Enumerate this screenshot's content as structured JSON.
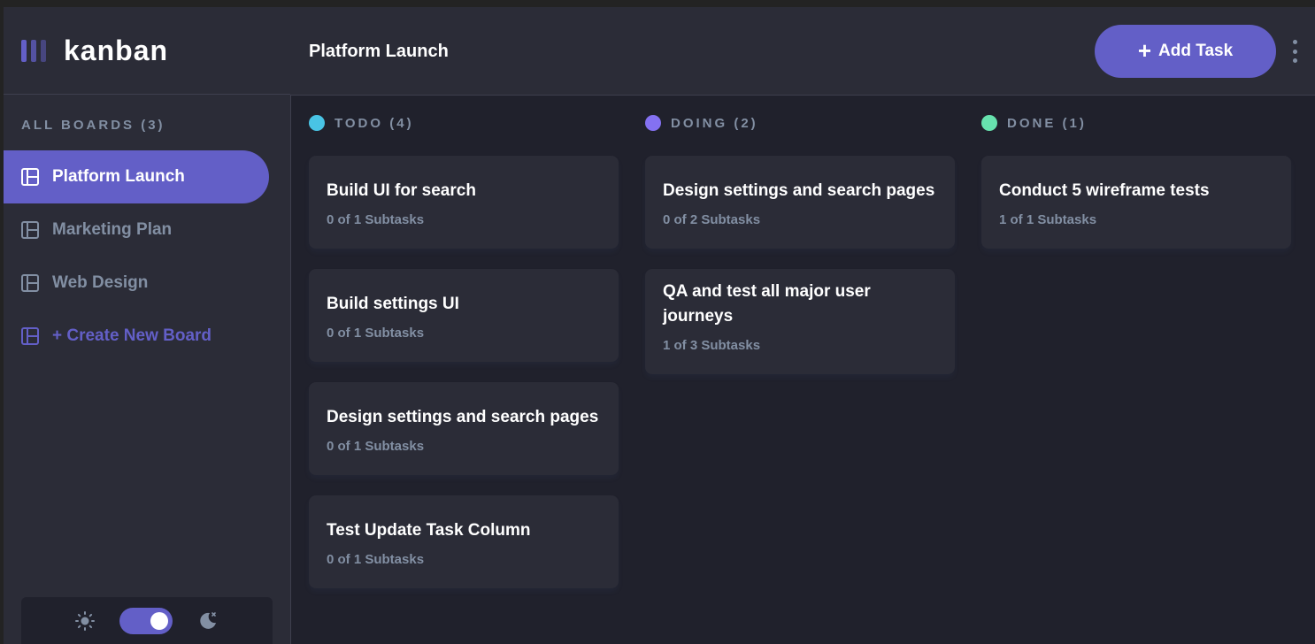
{
  "app": {
    "logo_text": "kanban"
  },
  "sidebar": {
    "boards_label": "ALL BOARDS (3)",
    "items": [
      {
        "label": "Platform Launch",
        "active": true
      },
      {
        "label": "Marketing Plan",
        "active": false
      },
      {
        "label": "Web Design",
        "active": false
      }
    ],
    "create_label": "+ Create New Board",
    "theme": {
      "light_icon": "sun-icon",
      "dark_icon": "moon-icon",
      "dark_mode": true
    }
  },
  "header": {
    "title": "Platform Launch",
    "add_task_label": "Add Task",
    "add_task_icon": "+"
  },
  "columns": [
    {
      "title": "TODO (4)",
      "color": "#49c4e5",
      "cards": [
        {
          "title": "Build UI for search",
          "subtasks": "0 of 1 Subtasks"
        },
        {
          "title": "Build settings UI",
          "subtasks": "0 of 1 Subtasks"
        },
        {
          "title": "Design settings and search pages",
          "subtasks": "0 of 1 Subtasks"
        },
        {
          "title": "Test Update Task Column",
          "subtasks": "0 of 1 Subtasks"
        }
      ]
    },
    {
      "title": "DOING (2)",
      "color": "#8471f2",
      "cards": [
        {
          "title": "Design settings and search pages",
          "subtasks": "0 of 2 Subtasks"
        },
        {
          "title": "QA and test all major user journeys",
          "subtasks": "1 of 3 Subtasks"
        }
      ]
    },
    {
      "title": "DONE (1)",
      "color": "#67e2ae",
      "cards": [
        {
          "title": "Conduct 5 wireframe tests",
          "subtasks": "1 of 1 Subtasks"
        }
      ]
    }
  ],
  "colors": {
    "accent": "#635fc7",
    "panel": "#2b2c37",
    "background": "#20212c",
    "muted": "#828fa3"
  }
}
